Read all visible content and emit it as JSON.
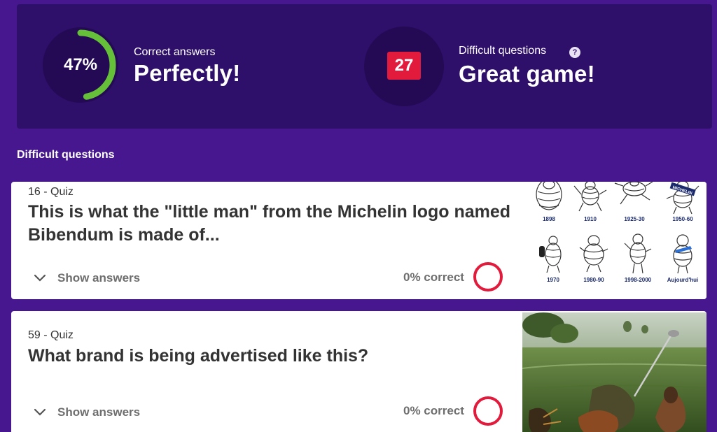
{
  "summary": {
    "correct": {
      "percent": 0.47,
      "percent_text": "47%",
      "label": "Correct answers",
      "value": "Perfectly!"
    },
    "difficult": {
      "count": "27",
      "label": "Difficult questions",
      "value": "Great game!",
      "help_icon": "?"
    }
  },
  "section_title": "Difficult questions",
  "questions": [
    {
      "meta": "16 -  Quiz",
      "text": "This is what the \"little man\" from the Michelin logo named Bibendum is made of...",
      "show_answers": "Show answers",
      "correct_text": "0% correct",
      "image": {
        "years": [
          "1898",
          "1910",
          "1925-30",
          "1950-60",
          "1970",
          "1980-90",
          "1998-2000",
          "Aujourd'hui"
        ],
        "badge_text": "MICHELIN"
      }
    },
    {
      "meta": "59 -  Quiz",
      "text": "What brand is being advertised like this?",
      "show_answers": "Show answers",
      "correct_text": "0% correct"
    }
  ],
  "colors": {
    "page_bg": "#46178f",
    "panel_bg": "#2e0f6a",
    "ring_green": "#66bf39",
    "badge_red": "#e21b3c"
  }
}
